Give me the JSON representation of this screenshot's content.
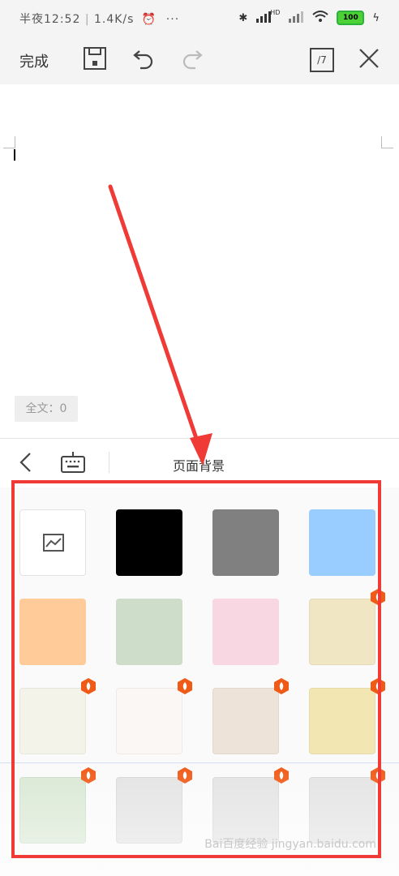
{
  "status_bar": {
    "time": "半夜12:52",
    "speed": "1.4K/s",
    "more": "···",
    "signal_hd": "HD",
    "battery": "100"
  },
  "toolbar": {
    "done_label": "完成",
    "save_icon": "save-icon",
    "undo_icon": "undo-icon",
    "redo_icon": "redo-icon",
    "page_label": "/7",
    "close_icon": "close-icon"
  },
  "editor": {
    "word_count": "全文：0"
  },
  "panel": {
    "title": "页面背景",
    "back_icon": "chevron-left-icon",
    "keyboard_icon": "keyboard-icon"
  },
  "backgrounds": [
    {
      "name": "custom-image",
      "color": "#ffffff",
      "premium": false
    },
    {
      "name": "black",
      "color": "#000000",
      "premium": false
    },
    {
      "name": "gray",
      "color": "#808080",
      "premium": false
    },
    {
      "name": "light-blue",
      "color": "#99ccff",
      "premium": false
    },
    {
      "name": "peach",
      "color": "#ffcc99",
      "premium": false
    },
    {
      "name": "sage-green",
      "color": "#cdddca",
      "premium": false
    },
    {
      "name": "pink",
      "color": "#f8d6e2",
      "premium": false
    },
    {
      "name": "cream-landscape",
      "color": "#f1e6c4",
      "premium": true
    },
    {
      "name": "ivory-ink",
      "color": "#f4f3ea",
      "premium": true
    },
    {
      "name": "floral-frame",
      "color": "#fbf7f4",
      "premium": true
    },
    {
      "name": "plum-blossom",
      "color": "#eee3d8",
      "premium": true
    },
    {
      "name": "yellow-cottage",
      "color": "#f2e6b3",
      "premium": true
    },
    {
      "name": "green-flowers",
      "color": "#d9e8d4",
      "premium": true
    },
    {
      "name": "gray-1",
      "color": "#e3e3e3",
      "premium": true
    },
    {
      "name": "gray-2",
      "color": "#e3e3e3",
      "premium": true
    },
    {
      "name": "gray-3",
      "color": "#e3e3e3",
      "premium": true
    }
  ],
  "colors": {
    "annotation_red": "#f03a36",
    "premium_badge": "#f05a17"
  },
  "watermark": "Bai百度经验 jingyan.baidu.com"
}
